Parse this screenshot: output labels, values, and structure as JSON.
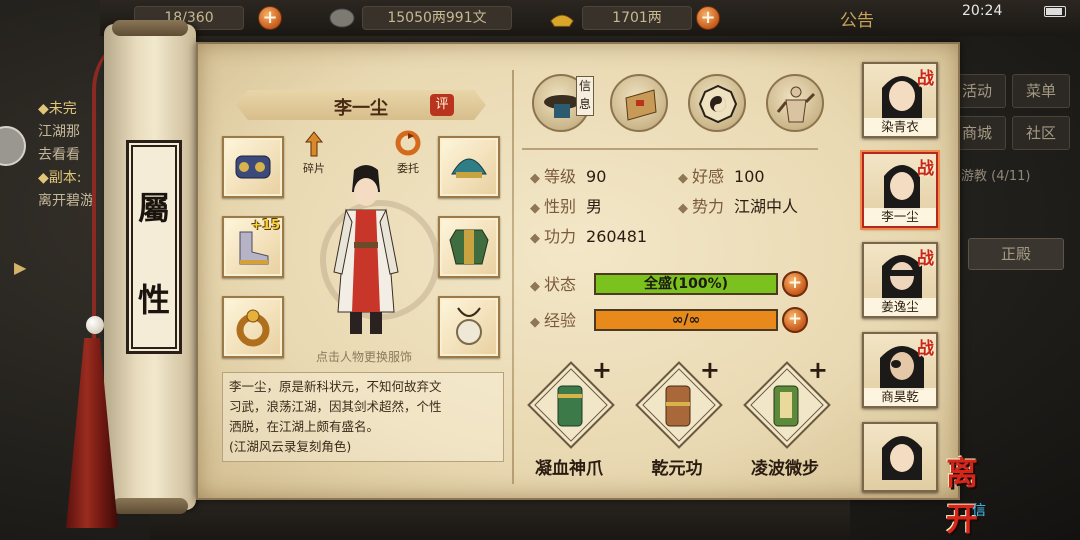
{
  "topbar": {
    "bag_label": "18/360",
    "money_label": "15050两991文",
    "ingot_label": "1701两",
    "notice_label": "公告",
    "time": "20:24"
  },
  "quest_panel": {
    "line1": "◆未完",
    "line2": "江湖那",
    "line3": "去看看",
    "line4": "◆副本:",
    "line5": "离开碧游"
  },
  "right_menu": {
    "activity": "活动",
    "menu": "菜单",
    "shop": "商城",
    "community": "社区",
    "faction_progress": "碧游教 (4/11)",
    "zheng_button": "正殿"
  },
  "title_tab": {
    "line1": "屬",
    "line2": "性"
  },
  "character": {
    "name": "李一尘",
    "rate_badge": "评",
    "shard_label": "碎片",
    "entrust_label": "委托",
    "costume_hint": "点击人物更换服饰",
    "bio_lines": [
      "李一尘，原是新科状元，不知何故弃文",
      "习武，浪荡江湖，因其剑术超然，个性",
      "洒脱，在江湖上颇有盛名。",
      "(江湖风云录复刻角色)"
    ]
  },
  "equipment": [
    {
      "slot": "weapon",
      "plus": ""
    },
    {
      "slot": "helmet",
      "plus": ""
    },
    {
      "slot": "shoes",
      "plus": "+15"
    },
    {
      "slot": "armor",
      "plus": ""
    },
    {
      "slot": "ring",
      "plus": ""
    },
    {
      "slot": "amulet",
      "plus": ""
    }
  ],
  "tabs": {
    "xin_badge": "信息"
  },
  "stats": {
    "level_label": "等级",
    "level_value": "90",
    "favor_label": "好感",
    "favor_value": "100",
    "gender_label": "性别",
    "gender_value": "男",
    "faction_label": "势力",
    "faction_value": "江湖中人",
    "power_label": "功力",
    "power_value": "260481",
    "state_label": "状态",
    "state_value": "全盛(100%)",
    "state_fill": 1.0,
    "exp_label": "经验",
    "exp_value": "∞/∞",
    "exp_fill": 1.0
  },
  "skills": [
    {
      "name": "凝血神爪",
      "plus": "+"
    },
    {
      "name": "乾元功",
      "plus": "+"
    },
    {
      "name": "凌波微步",
      "plus": "+"
    }
  ],
  "roster": [
    {
      "name": "染青衣",
      "badge": "战",
      "selected": false
    },
    {
      "name": "李一尘",
      "badge": "战",
      "selected": true
    },
    {
      "name": "姜逸尘",
      "badge": "战",
      "selected": false
    },
    {
      "name": "商昊乾",
      "badge": "战",
      "selected": false
    },
    {
      "name": "",
      "badge": "",
      "selected": false
    }
  ],
  "leave_label": "离开",
  "colors": {
    "state_bar": "#7cc21f",
    "exp_bar": "#e8891c",
    "accent_red": "#c8271b"
  }
}
